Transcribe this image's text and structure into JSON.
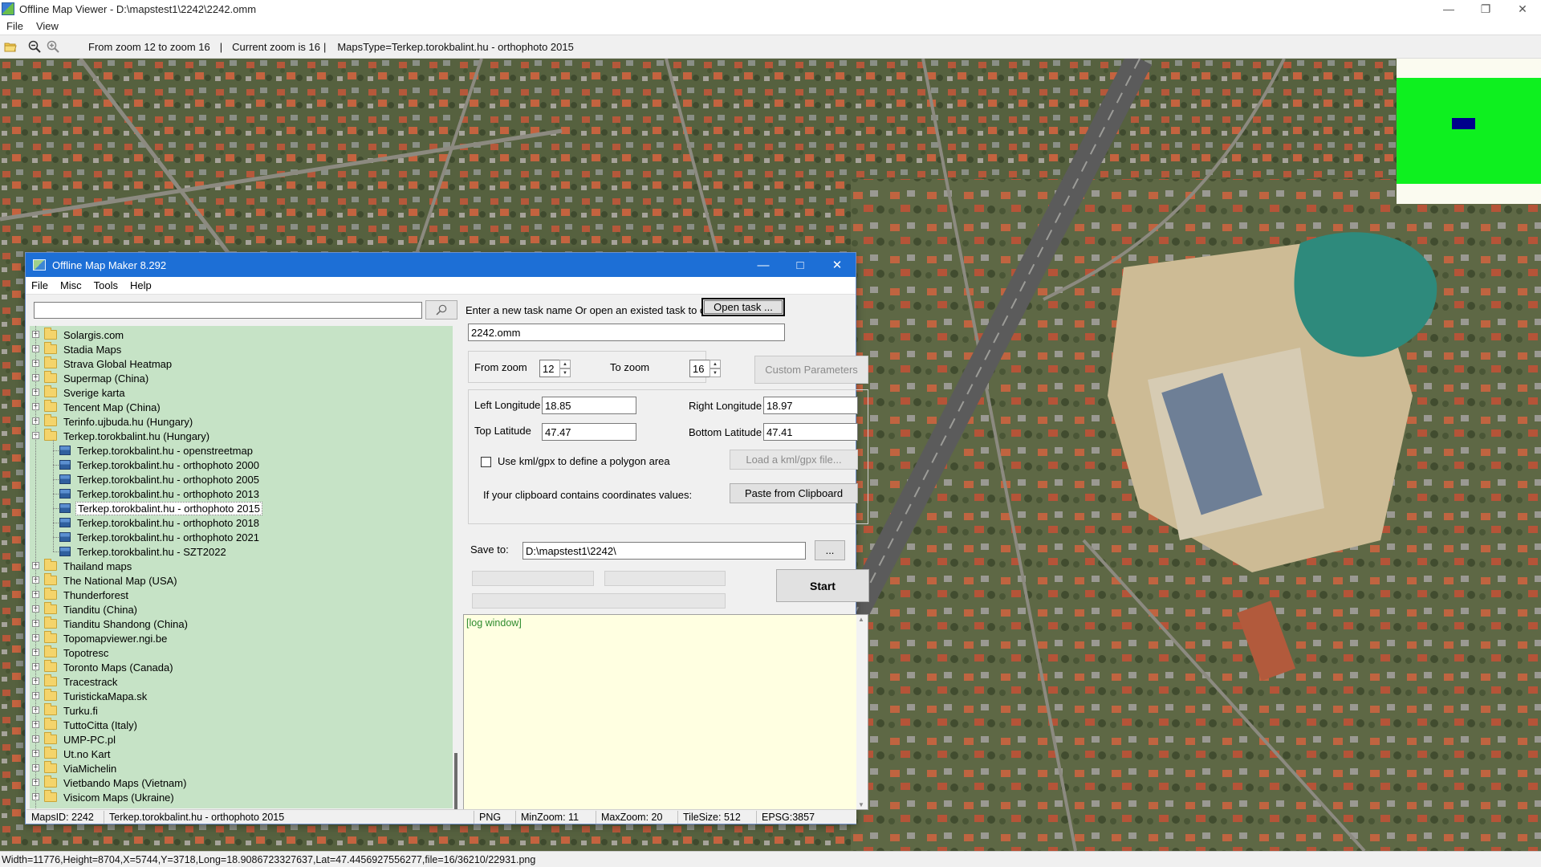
{
  "viewer": {
    "title": "Offline Map Viewer - D:\\mapstest1\\2242\\2242.omm",
    "menu": [
      "File",
      "View"
    ],
    "toolbar": {
      "zoom_range": "From zoom 12 to zoom 16",
      "sep1": "|",
      "current_zoom": "Current zoom is 16",
      "sep2": "|",
      "maps_type": "MapsType=Terkep.torokbalint.hu - orthophoto 2015"
    },
    "status": "Width=11776,Height=8704,X=5744,Y=3718,Long=18.9086723327637,Lat=47.4456927556277,file=16/36210/22931.png",
    "minimap_colors": {
      "background": "#0ef01f",
      "viewport": "#00008b"
    }
  },
  "dialog": {
    "title": "Offline Map Maker 8.292",
    "menu": [
      "File",
      "Misc",
      "Tools",
      "Help"
    ],
    "search": {
      "value": "",
      "button_icon": "search-icon"
    },
    "tree": [
      {
        "label": "Solargis.com",
        "type": "folder",
        "expanded": false
      },
      {
        "label": "Stadia Maps",
        "type": "folder",
        "expanded": false
      },
      {
        "label": "Strava Global Heatmap",
        "type": "folder",
        "expanded": false
      },
      {
        "label": "Supermap (China)",
        "type": "folder",
        "expanded": false
      },
      {
        "label": "Sverige karta",
        "type": "folder",
        "expanded": false
      },
      {
        "label": "Tencent Map (China)",
        "type": "folder",
        "expanded": false
      },
      {
        "label": "Terinfo.ujbuda.hu (Hungary)",
        "type": "folder",
        "expanded": false
      },
      {
        "label": "Terkep.torokbalint.hu (Hungary)",
        "type": "folder",
        "expanded": true
      },
      {
        "label": "Terkep.torokbalint.hu - openstreetmap",
        "type": "map",
        "expanded": false
      },
      {
        "label": "Terkep.torokbalint.hu - orthophoto 2000",
        "type": "map",
        "expanded": false
      },
      {
        "label": "Terkep.torokbalint.hu - orthophoto 2005",
        "type": "map",
        "expanded": false
      },
      {
        "label": "Terkep.torokbalint.hu - orthophoto 2013",
        "type": "map",
        "expanded": false
      },
      {
        "label": "Terkep.torokbalint.hu - orthophoto 2015",
        "type": "map",
        "selected": true
      },
      {
        "label": "Terkep.torokbalint.hu - orthophoto 2018",
        "type": "map",
        "expanded": false
      },
      {
        "label": "Terkep.torokbalint.hu - orthophoto 2021",
        "type": "map",
        "expanded": false
      },
      {
        "label": "Terkep.torokbalint.hu - SZT2022",
        "type": "map",
        "expanded": false
      },
      {
        "label": "Thailand maps",
        "type": "folder",
        "expanded": false
      },
      {
        "label": "The National Map (USA)",
        "type": "folder",
        "expanded": false
      },
      {
        "label": "Thunderforest",
        "type": "folder",
        "expanded": false
      },
      {
        "label": "Tianditu (China)",
        "type": "folder",
        "expanded": false
      },
      {
        "label": "Tianditu Shandong (China)",
        "type": "folder",
        "expanded": false
      },
      {
        "label": "Topomapviewer.ngi.be",
        "type": "folder",
        "expanded": false
      },
      {
        "label": "Topotresc",
        "type": "folder",
        "expanded": false
      },
      {
        "label": "Toronto Maps (Canada)",
        "type": "folder",
        "expanded": false
      },
      {
        "label": "Tracestrack",
        "type": "folder",
        "expanded": false
      },
      {
        "label": "TuristickaMapa.sk",
        "type": "folder",
        "expanded": false
      },
      {
        "label": "Turku.fi",
        "type": "folder",
        "expanded": false
      },
      {
        "label": "TuttoCitta (Italy)",
        "type": "folder",
        "expanded": false
      },
      {
        "label": "UMP-PC.pl",
        "type": "folder",
        "expanded": false
      },
      {
        "label": "Ut.no Kart",
        "type": "folder",
        "expanded": false
      },
      {
        "label": "ViaMichelin",
        "type": "folder",
        "expanded": false
      },
      {
        "label": "Vietbando Maps (Vietnam)",
        "type": "folder",
        "expanded": false
      },
      {
        "label": "Visicom Maps (Ukraine)",
        "type": "folder",
        "expanded": false
      }
    ],
    "task_prompt": "Enter a new task name Or open an existed task to continue:",
    "open_task_button": "Open task ...",
    "task_name": "2242.omm",
    "from_zoom_label": "From zoom",
    "from_zoom_value": "12",
    "to_zoom_label": "To zoom",
    "to_zoom_value": "16",
    "custom_params_button": "Custom Parameters",
    "left_longitude_label": "Left Longitude",
    "left_longitude_value": "18.85",
    "right_longitude_label": "Right Longitude",
    "right_longitude_value": "18.97",
    "top_latitude_label": "Top Latitude",
    "top_latitude_value": "47.47",
    "bottom_latitude_label": "Bottom Latitude",
    "bottom_latitude_value": "47.41",
    "kml_checkbox_label": "Use kml/gpx to define a polygon area",
    "kml_checked": false,
    "load_kml_button": "Load a kml/gpx file...",
    "clipboard_label": "If your clipboard contains coordinates values:",
    "paste_button": "Paste from Clipboard",
    "save_to_label": "Save to:",
    "save_to_value": "D:\\mapstest1\\2242\\",
    "browse_button": "...",
    "start_button": "Start",
    "log_text": "[log window]",
    "status": {
      "maps_id": "MapsID: 2242",
      "map_name": "Terkep.torokbalint.hu - orthophoto 2015",
      "format": "PNG",
      "min_zoom": "MinZoom: 11",
      "max_zoom": "MaxZoom: 20",
      "tile_size": "TileSize: 512",
      "epsg": "EPSG:3857"
    }
  }
}
